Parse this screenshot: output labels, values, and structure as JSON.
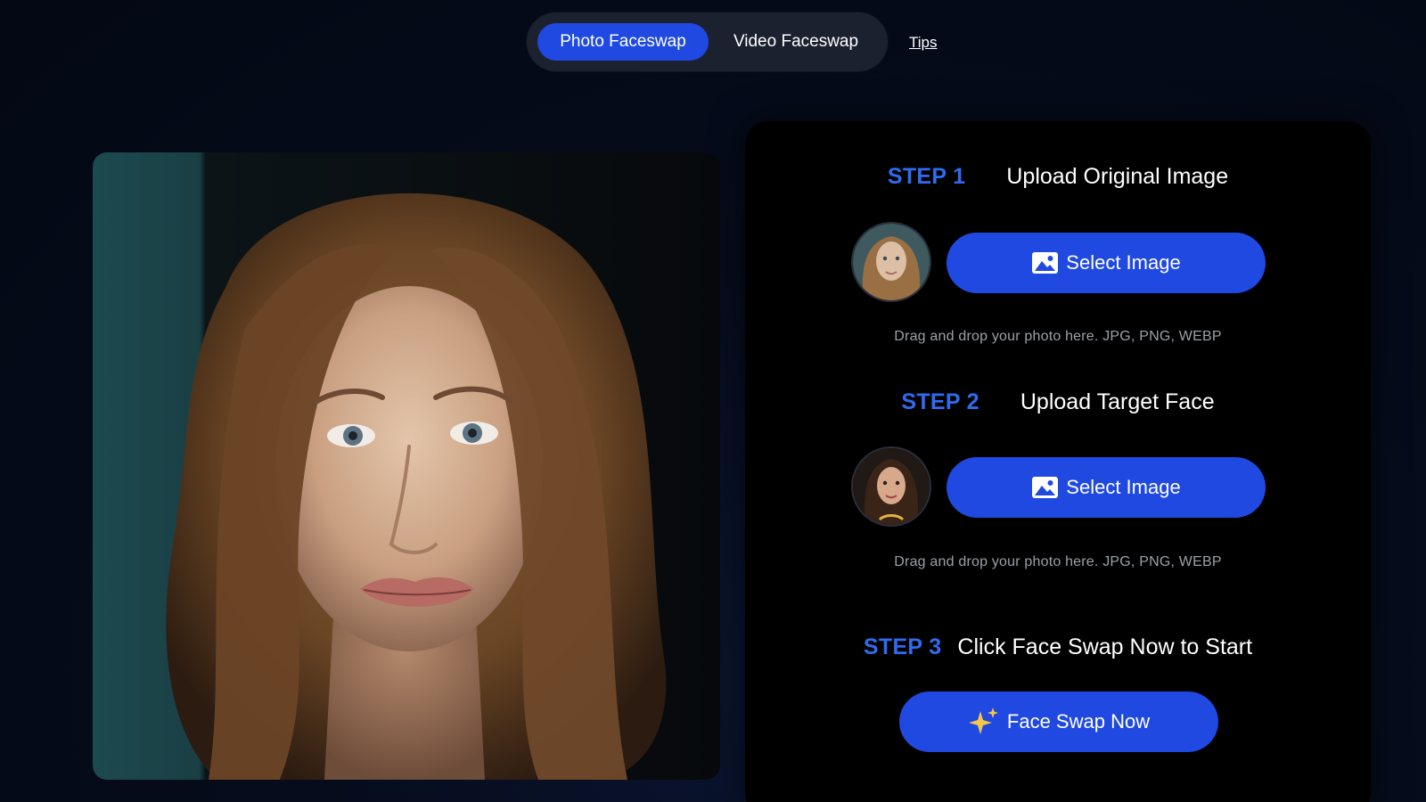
{
  "modes": {
    "photo_label": "Photo Faceswap",
    "video_label": "Video Faceswap",
    "active": "Photo Faceswap"
  },
  "tips_label": "Tips",
  "steps": [
    {
      "label": "STEP 1",
      "title": "Upload Original Image",
      "button_label": "Select Image",
      "hint": "Drag and drop your photo here. JPG, PNG, WEBP"
    },
    {
      "label": "STEP 2",
      "title": "Upload Target Face",
      "button_label": "Select Image",
      "hint": "Drag and drop your photo here. JPG, PNG, WEBP"
    },
    {
      "label": "STEP 3",
      "title": "Click Face Swap Now to Start",
      "button_label": "Face Swap Now"
    }
  ],
  "icons": {
    "select_button_icon": "image-icon",
    "swap_button_icon": "sparkle-icon"
  },
  "colors": {
    "accent": "#1f49e0",
    "step_label": "#2f6bf0",
    "panel_bg": "#000000",
    "hint_text": "#9aa0aa"
  }
}
